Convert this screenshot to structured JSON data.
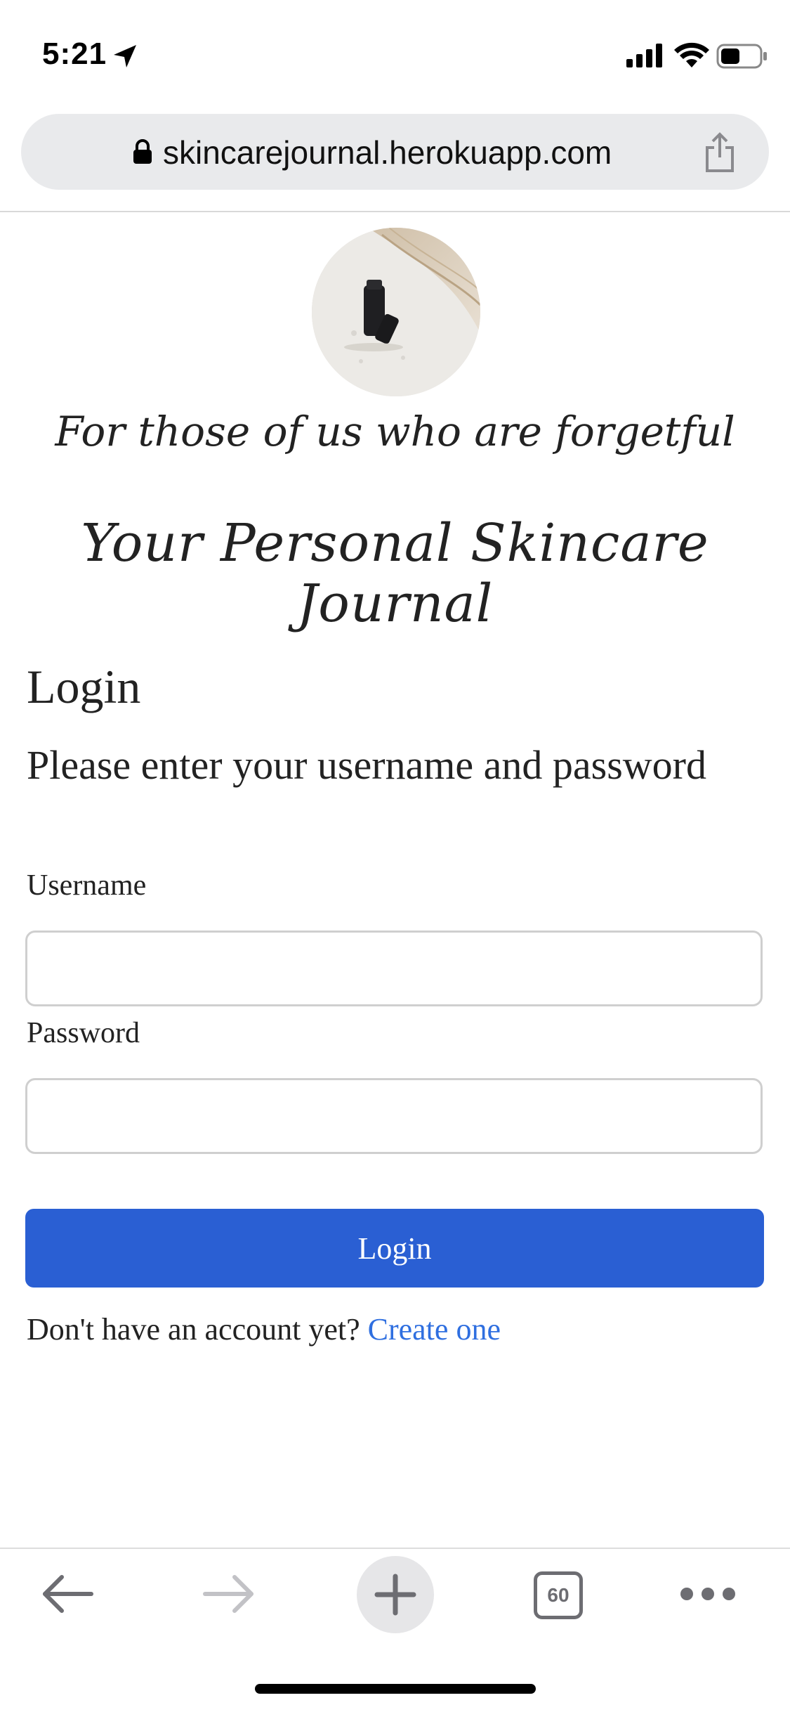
{
  "status_bar": {
    "time": "5:21"
  },
  "browser": {
    "url": "skincarejournal.herokuapp.com",
    "tab_count": "60"
  },
  "page": {
    "tagline": "For those of us who are forgetful",
    "title": "Your Personal Skincare Journal",
    "login_heading": "Login",
    "prompt": "Please enter your username and password",
    "username_label": "Username",
    "username_value": "",
    "password_label": "Password",
    "password_value": "",
    "login_button": "Login",
    "signup_text": "Don't have an account yet?",
    "signup_link": "Create one"
  },
  "colors": {
    "button": "#2a5fd3",
    "link": "#2f6fe0"
  }
}
